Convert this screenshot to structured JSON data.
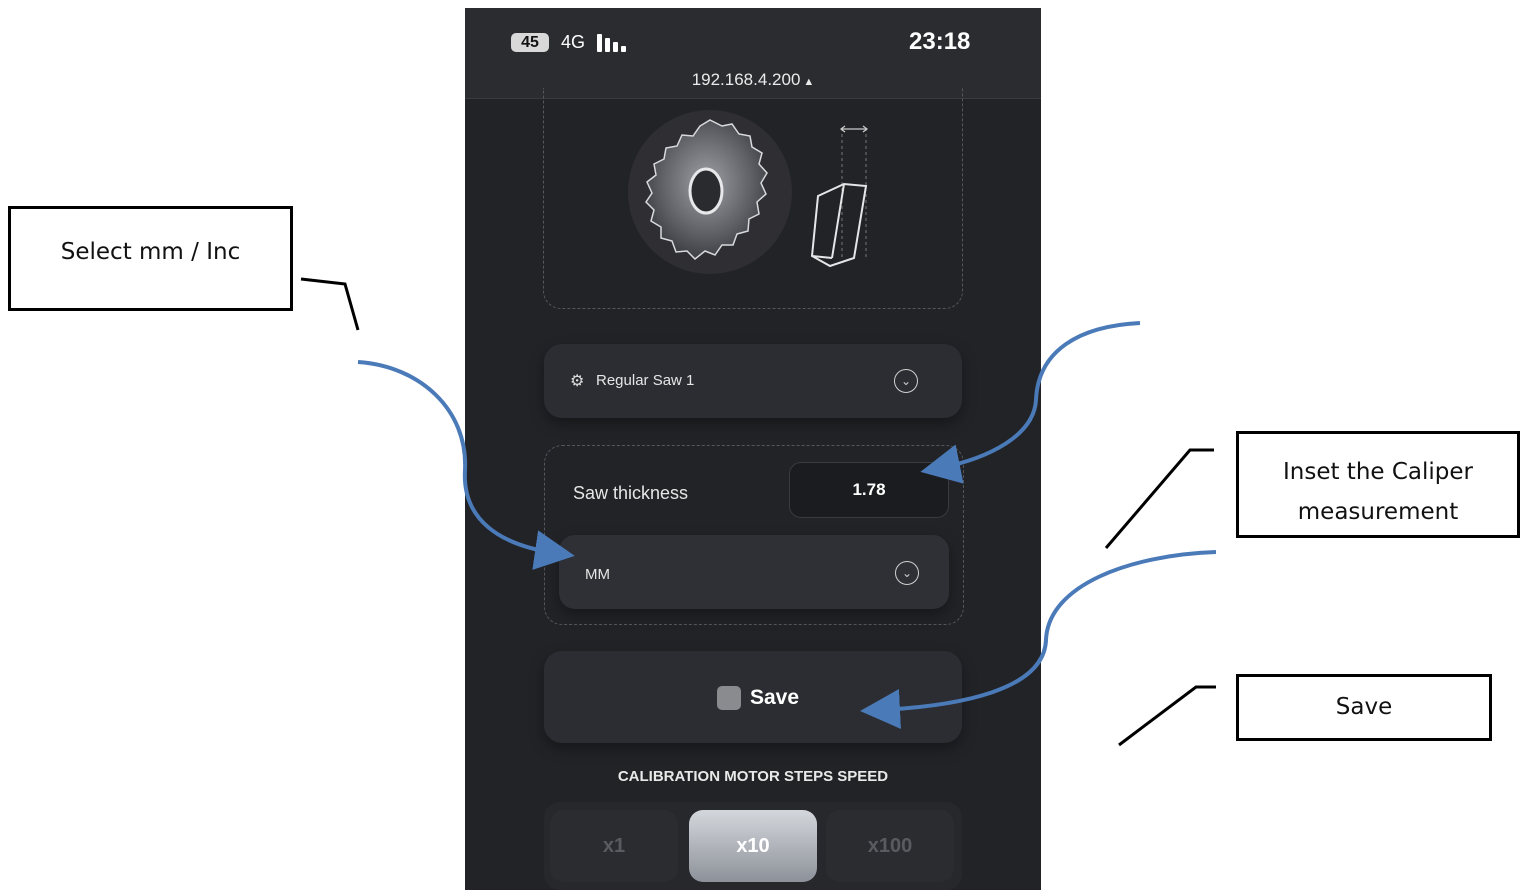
{
  "status_bar": {
    "battery": "45",
    "network": "4G",
    "time": "23:18",
    "url": "192.168.4.200"
  },
  "saw_selector": {
    "selected": "Regular Saw 1",
    "icon": "gear-icon"
  },
  "thickness": {
    "label": "Saw thickness",
    "value": "1.78",
    "unit": "MM"
  },
  "save_button": {
    "label": "Save"
  },
  "calibration": {
    "title": "CALIBRATION MOTOR STEPS SPEED",
    "options": [
      "x1",
      "x10",
      "x100"
    ],
    "selected": "x10"
  },
  "annotations": {
    "unit_callout": "Select mm / Inc",
    "caliper_callout_line1": "Inset the Caliper",
    "caliper_callout_line2": "measurement",
    "save_callout": "Save",
    "arrow_color": "#4a7ab8"
  }
}
